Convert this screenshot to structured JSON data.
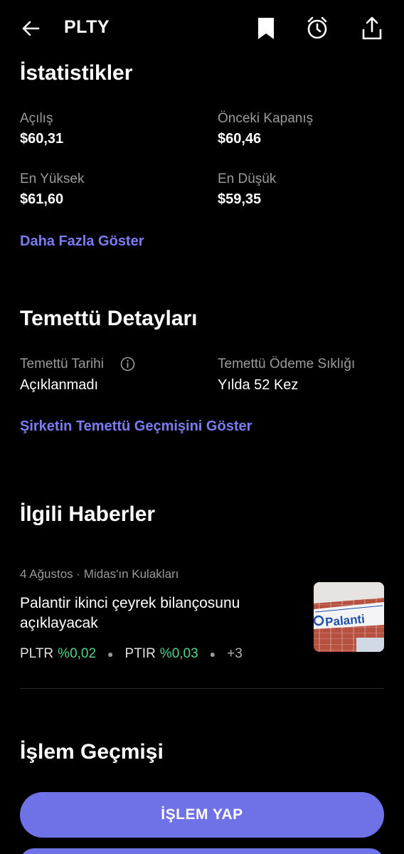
{
  "header": {
    "ticker": "PLTY",
    "icons": [
      "back-arrow-icon",
      "bookmark-icon",
      "alarm-icon",
      "share-icon"
    ]
  },
  "stats": {
    "title": "İstatistikler",
    "open_label": "Açılış",
    "open_value": "$60,31",
    "prev_close_label": "Önceki Kapanış",
    "prev_close_value": "$60,46",
    "high_label": "En Yüksek",
    "high_value": "$61,60",
    "low_label": "En Düşük",
    "low_value": "$59,35",
    "show_more": "Daha Fazla Göster"
  },
  "dividend": {
    "title": "Temettü Detayları",
    "date_label": "Temettü Tarihi",
    "date_value": "Açıklanmadı",
    "freq_label": "Temettü Ödeme Sıklığı",
    "freq_value": "Yılda 52 Kez",
    "history_link": "Şirketin Temettü Geçmişini Göster"
  },
  "news": {
    "title": "İlgili Haberler",
    "meta": "4 Ağustos · Midas'ın Kulakları",
    "headline": "Palantir ikinci çeyrek bilançosunu açıklayacak",
    "tags": [
      {
        "symbol": "PLTR",
        "change": "%0,02"
      },
      {
        "symbol": "PTIR",
        "change": "%0,03"
      }
    ],
    "more": "+3",
    "thumb_text": "Palanti"
  },
  "history": {
    "title": "İşlem Geçmişi",
    "trade_button": "İŞLEM YAP"
  },
  "colors": {
    "accent": "#6f71e6",
    "link": "#7c7cf2",
    "positive": "#4fd48a",
    "muted": "#9a9a9a"
  }
}
